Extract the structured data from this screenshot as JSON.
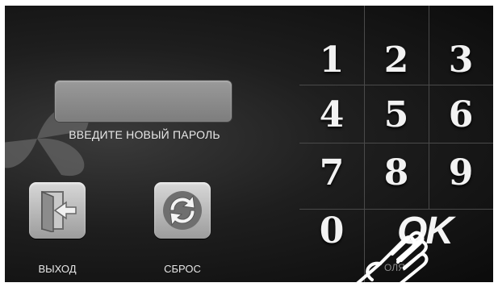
{
  "prompt": {
    "text": "ВВЕДИТЕ НОВЫЙ ПАРОЛЬ"
  },
  "password_field": {
    "value": ""
  },
  "buttons": {
    "exit_label": "ВЫХОД",
    "reset_label": "СБРОС"
  },
  "keypad": {
    "keys": [
      "1",
      "2",
      "3",
      "4",
      "5",
      "6",
      "7",
      "8",
      "9",
      "0"
    ],
    "ok_label": "OK"
  },
  "footer": {
    "partial_label": "ОЛЯ"
  },
  "colors": {
    "background": "#111111",
    "accent": "#f2f2f2"
  }
}
